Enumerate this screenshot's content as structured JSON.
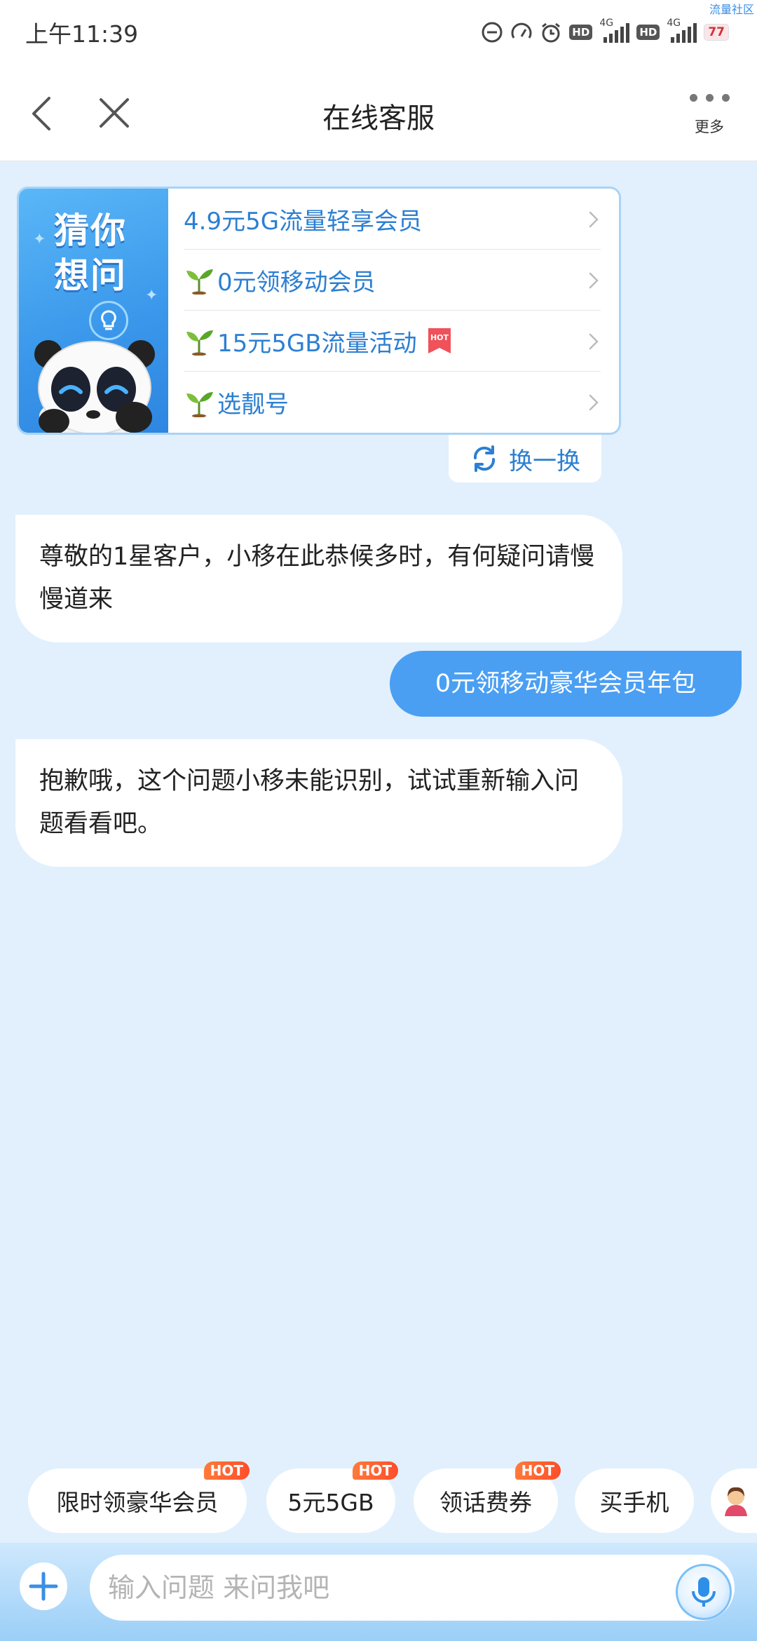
{
  "status_bar": {
    "time": "上午11:39",
    "hd_label": "HD",
    "network_label": "4G",
    "battery": "77",
    "corner_text": "流量社区"
  },
  "nav": {
    "title": "在线客服",
    "more_label": "更多"
  },
  "guess": {
    "banner_title": "猜你想问",
    "items": [
      {
        "label": "4.9元5G流量轻享会员",
        "sprout": false,
        "hot": false
      },
      {
        "label": "0元领移动会员",
        "sprout": true,
        "hot": false
      },
      {
        "label": "15元5GB流量活动",
        "sprout": true,
        "hot": true
      },
      {
        "label": "选靓号",
        "sprout": true,
        "hot": false
      }
    ],
    "hot_tag": "HOT",
    "refresh_label": "换一换"
  },
  "messages": [
    {
      "role": "bot",
      "text": "尊敬的1星客户，小移在此恭候多时，有何疑问请慢慢道来"
    },
    {
      "role": "user",
      "text": "0元领移动豪华会员年包"
    },
    {
      "role": "bot",
      "text": "抱歉哦，这个问题小移未能识别，试试重新输入问题看看吧。"
    }
  ],
  "quick_chips": [
    {
      "label": "限时领豪华会员",
      "hot": "HOT"
    },
    {
      "label": "5元5GB",
      "hot": "HOT"
    },
    {
      "label": "领话费券",
      "hot": "HOT"
    },
    {
      "label": "买手机",
      "hot": ""
    }
  ],
  "input": {
    "placeholder": "输入问题 来问我吧"
  },
  "colors": {
    "page_bg": "#e1f0fc",
    "accent": "#2c7fd2",
    "user_bubble": "#4a9ff3",
    "hot": "#ff5a2e"
  }
}
